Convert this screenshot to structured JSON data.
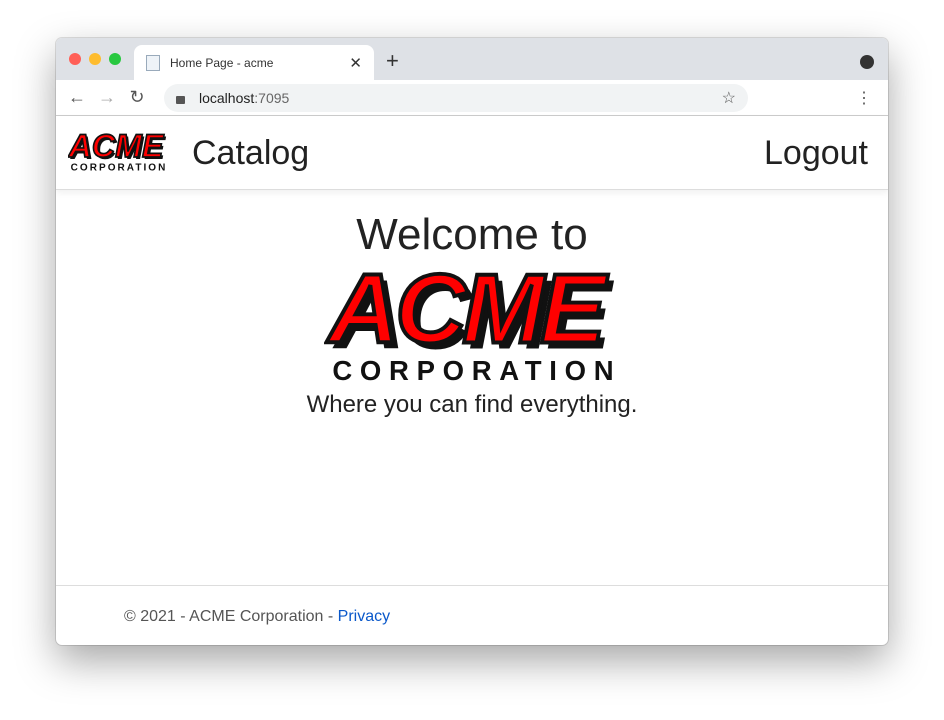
{
  "browser": {
    "tab_title": "Home Page - acme",
    "url_host": "localhost",
    "url_port": ":7095",
    "colors": {
      "close": "#ff5f57",
      "min": "#febc2e",
      "max": "#28c840"
    }
  },
  "nav": {
    "logo_text": "ACME",
    "logo_sub": "CORPORATION",
    "catalog": "Catalog",
    "logout": "Logout"
  },
  "main": {
    "heading": "Welcome to",
    "tagline": "Where you can find everything."
  },
  "footer": {
    "copyright": "© 2021 - ACME Corporation - ",
    "privacy": "Privacy"
  },
  "brand": {
    "red": "#ff0000",
    "dark": "#1a1a1a"
  }
}
